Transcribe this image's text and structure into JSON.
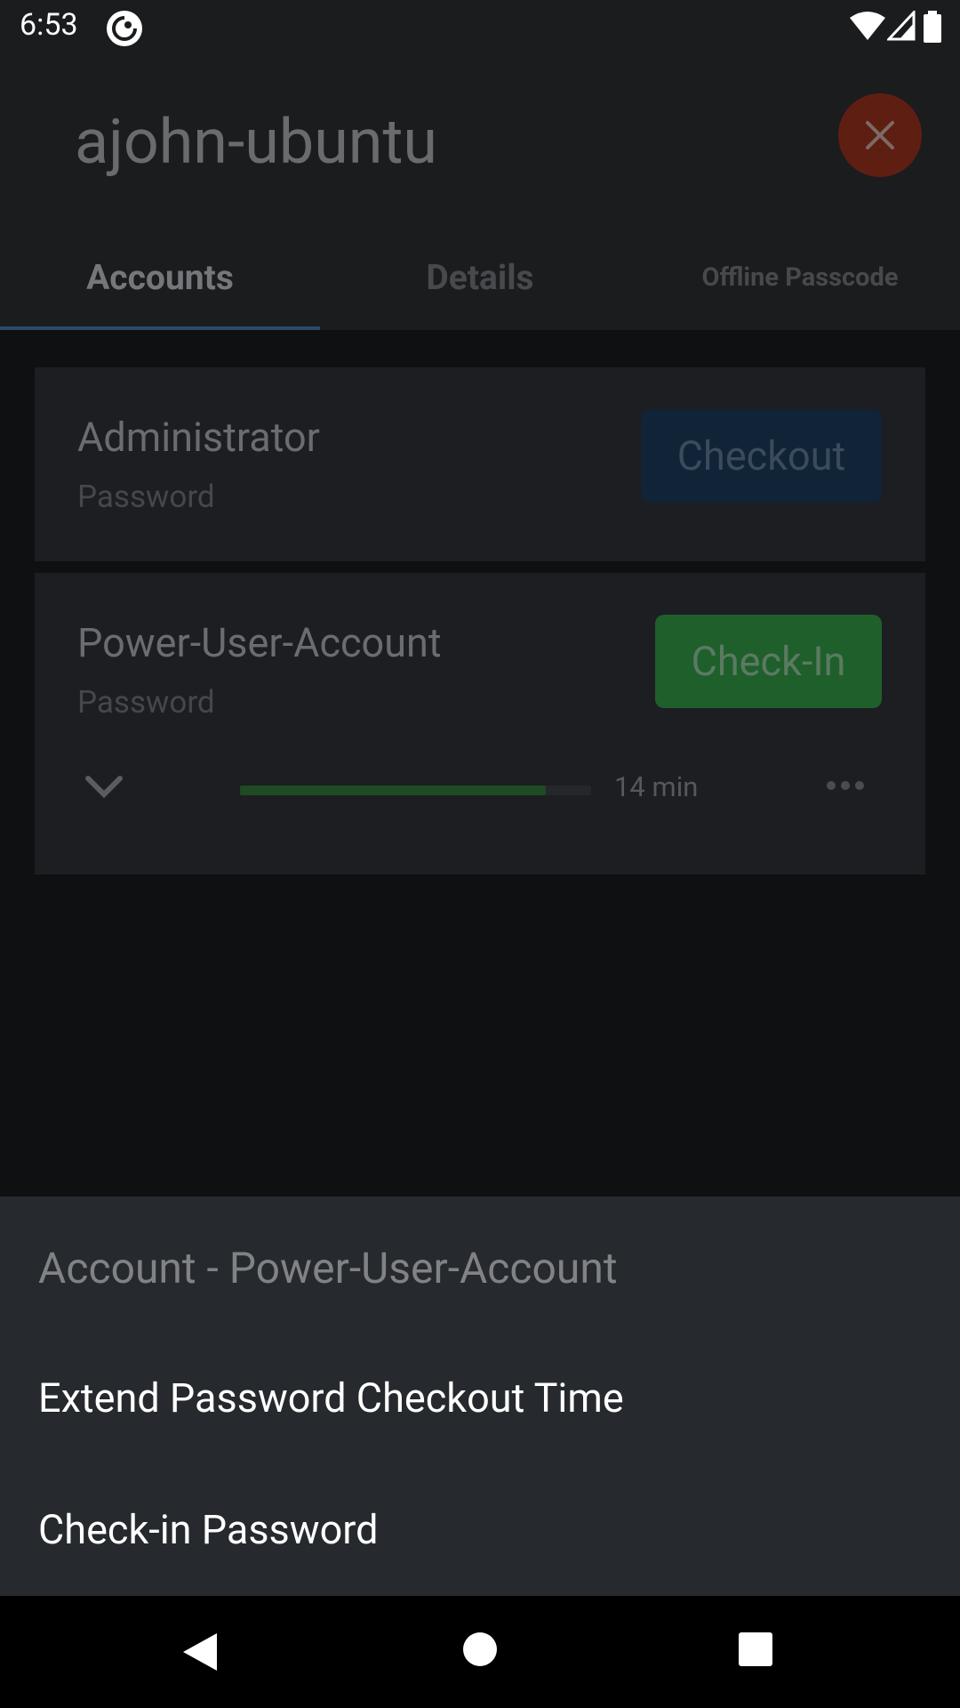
{
  "status_bar": {
    "time": "6:53",
    "icons": [
      "app-notification-icon",
      "wifi-icon",
      "cell-signal-icon",
      "battery-icon"
    ]
  },
  "header": {
    "title": "ajohn-ubuntu",
    "close_icon": "close-icon",
    "accent_color": "#5f1e12"
  },
  "tabs": [
    {
      "label": "Accounts",
      "selected": true
    },
    {
      "label": "Details",
      "selected": false
    },
    {
      "label": "Offline Passcode",
      "selected": false
    }
  ],
  "accounts": [
    {
      "name": "Administrator",
      "type": "Password",
      "action": "Checkout",
      "action_color": "#112337"
    },
    {
      "name": "Power-User-Account",
      "type": "Password",
      "action": "Check-In",
      "action_color": "#1f5f2c",
      "time_remaining": "14 min",
      "progress_fraction": 0.87
    }
  ],
  "bottom_sheet": {
    "title": "Account - Power-User-Account",
    "items": [
      {
        "label": "Extend Password Checkout Time"
      },
      {
        "label": "Check-in Password"
      }
    ]
  },
  "nav_bar": {
    "icons": [
      "back-icon",
      "home-icon",
      "recents-icon"
    ]
  }
}
